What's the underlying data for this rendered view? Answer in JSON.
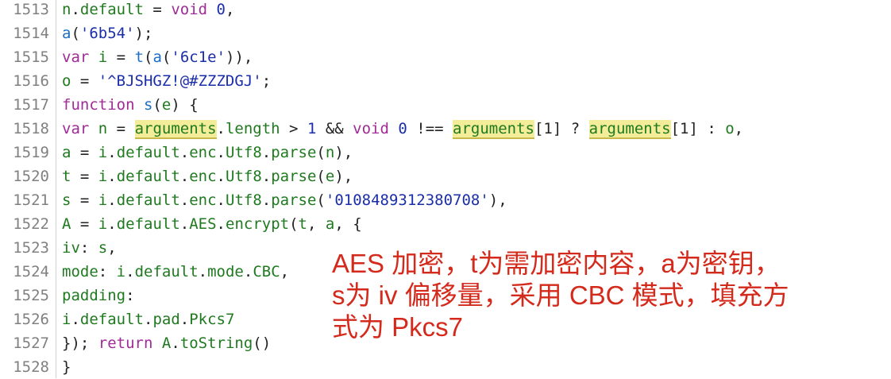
{
  "colors": {
    "keyword": "#a02a96",
    "function": "#1c6fc4",
    "string": "#1b2eaa",
    "property": "#1f7a1f",
    "number": "#1b2eaa",
    "punctuation": "#222222",
    "line_number": "#808080",
    "annotation": "#d42a1c",
    "highlight_bg": "#f3ed9a"
  },
  "lines": [
    {
      "num": "1513",
      "tokens": [
        {
          "t": "n",
          "c": "property"
        },
        {
          "t": ".",
          "c": "punctuation"
        },
        {
          "t": "default",
          "c": "property"
        },
        {
          "t": " = ",
          "c": "punctuation"
        },
        {
          "t": "void",
          "c": "keyword"
        },
        {
          "t": " ",
          "c": "punctuation"
        },
        {
          "t": "0",
          "c": "number"
        },
        {
          "t": ",",
          "c": "punctuation"
        }
      ]
    },
    {
      "num": "1514",
      "tokens": [
        {
          "t": "a",
          "c": "function"
        },
        {
          "t": "(",
          "c": "punctuation"
        },
        {
          "t": "'6b54'",
          "c": "string"
        },
        {
          "t": ");",
          "c": "punctuation"
        }
      ]
    },
    {
      "num": "1515",
      "tokens": [
        {
          "t": "var",
          "c": "keyword"
        },
        {
          "t": " ",
          "c": "punctuation"
        },
        {
          "t": "i",
          "c": "property"
        },
        {
          "t": " = ",
          "c": "punctuation"
        },
        {
          "t": "t",
          "c": "function"
        },
        {
          "t": "(",
          "c": "punctuation"
        },
        {
          "t": "a",
          "c": "function"
        },
        {
          "t": "(",
          "c": "punctuation"
        },
        {
          "t": "'6c1e'",
          "c": "string"
        },
        {
          "t": ")),",
          "c": "punctuation"
        }
      ]
    },
    {
      "num": "1516",
      "tokens": [
        {
          "t": "o",
          "c": "property"
        },
        {
          "t": " = ",
          "c": "punctuation"
        },
        {
          "t": "'^BJSHGZ!@#ZZZDGJ'",
          "c": "string"
        },
        {
          "t": ";",
          "c": "punctuation"
        }
      ]
    },
    {
      "num": "1517",
      "tokens": [
        {
          "t": "function",
          "c": "keyword"
        },
        {
          "t": " ",
          "c": "punctuation"
        },
        {
          "t": "s",
          "c": "function"
        },
        {
          "t": "(",
          "c": "punctuation"
        },
        {
          "t": "e",
          "c": "property"
        },
        {
          "t": ") {",
          "c": "punctuation"
        }
      ]
    },
    {
      "num": "1518",
      "tokens": [
        {
          "t": "var",
          "c": "keyword"
        },
        {
          "t": " ",
          "c": "punctuation"
        },
        {
          "t": "n",
          "c": "property"
        },
        {
          "t": " = ",
          "c": "punctuation"
        },
        {
          "t": "arguments",
          "c": "property",
          "hl": true
        },
        {
          "t": ".",
          "c": "punctuation"
        },
        {
          "t": "length",
          "c": "property"
        },
        {
          "t": " > ",
          "c": "punctuation"
        },
        {
          "t": "1",
          "c": "number"
        },
        {
          "t": " && ",
          "c": "punctuation"
        },
        {
          "t": "void",
          "c": "keyword"
        },
        {
          "t": " ",
          "c": "punctuation"
        },
        {
          "t": "0",
          "c": "number"
        },
        {
          "t": " !== ",
          "c": "punctuation"
        },
        {
          "t": "arguments",
          "c": "property",
          "hl": true
        },
        {
          "t": "[1] ? ",
          "c": "punctuation"
        },
        {
          "t": "arguments",
          "c": "property",
          "hl": true
        },
        {
          "t": "[1] : ",
          "c": "punctuation"
        },
        {
          "t": "o",
          "c": "property"
        },
        {
          "t": ",",
          "c": "punctuation"
        }
      ]
    },
    {
      "num": "1519",
      "tokens": [
        {
          "t": "a",
          "c": "property"
        },
        {
          "t": " = ",
          "c": "punctuation"
        },
        {
          "t": "i",
          "c": "property"
        },
        {
          "t": ".",
          "c": "punctuation"
        },
        {
          "t": "default",
          "c": "property"
        },
        {
          "t": ".",
          "c": "punctuation"
        },
        {
          "t": "enc",
          "c": "property"
        },
        {
          "t": ".",
          "c": "punctuation"
        },
        {
          "t": "Utf8",
          "c": "property"
        },
        {
          "t": ".",
          "c": "punctuation"
        },
        {
          "t": "parse",
          "c": "property"
        },
        {
          "t": "(",
          "c": "punctuation"
        },
        {
          "t": "n",
          "c": "property"
        },
        {
          "t": "),",
          "c": "punctuation"
        }
      ]
    },
    {
      "num": "1520",
      "tokens": [
        {
          "t": "t",
          "c": "property"
        },
        {
          "t": " = ",
          "c": "punctuation"
        },
        {
          "t": "i",
          "c": "property"
        },
        {
          "t": ".",
          "c": "punctuation"
        },
        {
          "t": "default",
          "c": "property"
        },
        {
          "t": ".",
          "c": "punctuation"
        },
        {
          "t": "enc",
          "c": "property"
        },
        {
          "t": ".",
          "c": "punctuation"
        },
        {
          "t": "Utf8",
          "c": "property"
        },
        {
          "t": ".",
          "c": "punctuation"
        },
        {
          "t": "parse",
          "c": "property"
        },
        {
          "t": "(",
          "c": "punctuation"
        },
        {
          "t": "e",
          "c": "property"
        },
        {
          "t": "),",
          "c": "punctuation"
        }
      ]
    },
    {
      "num": "1521",
      "tokens": [
        {
          "t": "s",
          "c": "property"
        },
        {
          "t": " = ",
          "c": "punctuation"
        },
        {
          "t": "i",
          "c": "property"
        },
        {
          "t": ".",
          "c": "punctuation"
        },
        {
          "t": "default",
          "c": "property"
        },
        {
          "t": ".",
          "c": "punctuation"
        },
        {
          "t": "enc",
          "c": "property"
        },
        {
          "t": ".",
          "c": "punctuation"
        },
        {
          "t": "Utf8",
          "c": "property"
        },
        {
          "t": ".",
          "c": "punctuation"
        },
        {
          "t": "parse",
          "c": "property"
        },
        {
          "t": "(",
          "c": "punctuation"
        },
        {
          "t": "'0108489312380708'",
          "c": "string"
        },
        {
          "t": "),",
          "c": "punctuation"
        }
      ]
    },
    {
      "num": "1522",
      "tokens": [
        {
          "t": "A",
          "c": "property"
        },
        {
          "t": " = ",
          "c": "punctuation"
        },
        {
          "t": "i",
          "c": "property"
        },
        {
          "t": ".",
          "c": "punctuation"
        },
        {
          "t": "default",
          "c": "property"
        },
        {
          "t": ".",
          "c": "punctuation"
        },
        {
          "t": "AES",
          "c": "property"
        },
        {
          "t": ".",
          "c": "punctuation"
        },
        {
          "t": "encrypt",
          "c": "property"
        },
        {
          "t": "(",
          "c": "punctuation"
        },
        {
          "t": "t",
          "c": "property"
        },
        {
          "t": ", ",
          "c": "punctuation"
        },
        {
          "t": "a",
          "c": "property"
        },
        {
          "t": ", {",
          "c": "punctuation"
        }
      ]
    },
    {
      "num": "1523",
      "tokens": [
        {
          "t": "iv",
          "c": "property"
        },
        {
          "t": ": ",
          "c": "punctuation"
        },
        {
          "t": "s",
          "c": "property"
        },
        {
          "t": ",",
          "c": "punctuation"
        }
      ]
    },
    {
      "num": "1524",
      "tokens": [
        {
          "t": "mode",
          "c": "property"
        },
        {
          "t": ": ",
          "c": "punctuation"
        },
        {
          "t": "i",
          "c": "property"
        },
        {
          "t": ".",
          "c": "punctuation"
        },
        {
          "t": "default",
          "c": "property"
        },
        {
          "t": ".",
          "c": "punctuation"
        },
        {
          "t": "mode",
          "c": "property"
        },
        {
          "t": ".",
          "c": "punctuation"
        },
        {
          "t": "CBC",
          "c": "property"
        },
        {
          "t": ",",
          "c": "punctuation"
        }
      ]
    },
    {
      "num": "1525",
      "tokens": [
        {
          "t": "padding",
          "c": "property"
        },
        {
          "t": ":",
          "c": "punctuation"
        }
      ]
    },
    {
      "num": "1526",
      "tokens": [
        {
          "t": "i",
          "c": "property"
        },
        {
          "t": ".",
          "c": "punctuation"
        },
        {
          "t": "default",
          "c": "property"
        },
        {
          "t": ".",
          "c": "punctuation"
        },
        {
          "t": "pad",
          "c": "property"
        },
        {
          "t": ".",
          "c": "punctuation"
        },
        {
          "t": "Pkcs7",
          "c": "property"
        }
      ]
    },
    {
      "num": "1527",
      "tokens": [
        {
          "t": "}); ",
          "c": "punctuation"
        },
        {
          "t": "return",
          "c": "keyword"
        },
        {
          "t": " ",
          "c": "punctuation"
        },
        {
          "t": "A",
          "c": "property"
        },
        {
          "t": ".",
          "c": "punctuation"
        },
        {
          "t": "toString",
          "c": "property"
        },
        {
          "t": "()",
          "c": "punctuation"
        }
      ]
    },
    {
      "num": "1528",
      "tokens": [
        {
          "t": "}",
          "c": "punctuation"
        }
      ]
    }
  ],
  "annotation": {
    "line1": "AES 加密，t为需加密内容，a为密钥，",
    "line2": "s为 iv 偏移量，采用 CBC 模式，填充方",
    "line3": "式为 Pkcs7"
  }
}
